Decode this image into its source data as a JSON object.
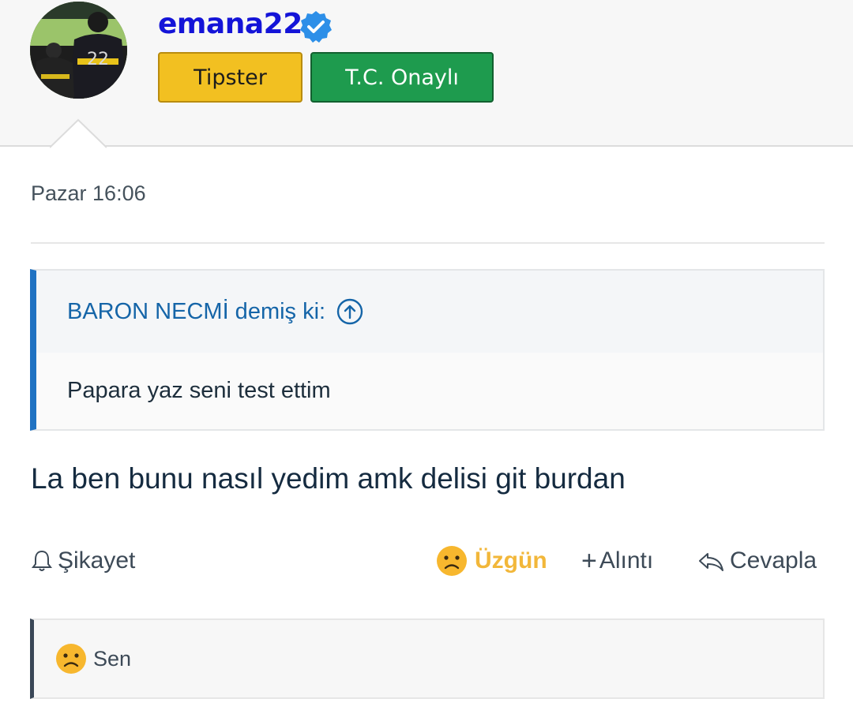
{
  "user": {
    "name": "emana22",
    "badges": [
      "Tipster",
      "T.C. Onaylı"
    ]
  },
  "post": {
    "date": "Pazar 16:06",
    "quote": {
      "author_line": "BARON NECMİ demiş ki:",
      "text": "Papara yaz seni test ettim"
    },
    "message": "La ben bunu nasıl yedim amk delisi git burdan"
  },
  "actions": {
    "report": "Şikayet",
    "reaction": "Üzgün",
    "quote": "Alıntı",
    "quote_symbol": "+",
    "reply": "Cevapla"
  },
  "reactions_bar": {
    "text": "Sen"
  },
  "colors": {
    "username": "#1414d8",
    "verified": "#2d8fe8",
    "tipster_badge": "#f2c021",
    "onayli_badge": "#1e9b4e",
    "quote_accent": "#1f72c2",
    "reaction": "#f2b73a"
  },
  "icons": {
    "verified": "verified-check-icon",
    "quote_jump": "arrow-up-circle-icon",
    "report": "bell-icon",
    "reaction": "sad-face-icon",
    "quote": "plus-icon",
    "reply": "reply-arrow-icon"
  }
}
